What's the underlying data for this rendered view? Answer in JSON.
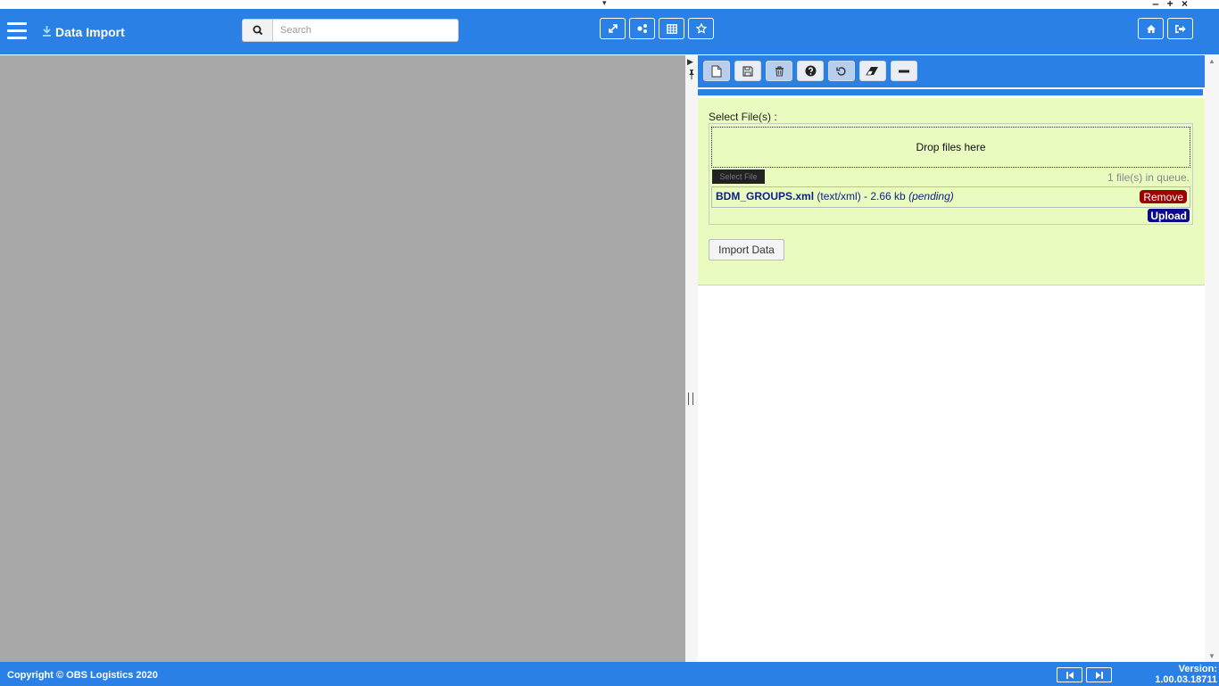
{
  "window": {
    "collapse_glyph": "▾",
    "controls": "‒ + ×"
  },
  "header": {
    "title": "Data Import",
    "search": {
      "placeholder": "Search",
      "value": ""
    },
    "tool_buttons": [
      "expand-icon",
      "share-icon",
      "grid-icon",
      "star-icon"
    ],
    "right_buttons": [
      "home-icon",
      "logout-icon"
    ]
  },
  "panel": {
    "toolbar": [
      "new-document-icon",
      "save-icon",
      "trash-icon",
      "help-icon",
      "refresh-icon",
      "eraser-icon",
      "minus-icon"
    ],
    "select_label": "Select File(s) :",
    "drop_text": "Drop files here",
    "select_file_label": "Select File",
    "queue_status": "1 file(s) in queue.",
    "file": {
      "name": "BDM_GROUPS.xml",
      "meta": "(text/xml) - 2.66 kb",
      "status": "(pending)"
    },
    "remove_label": "Remove",
    "upload_label": "Upload",
    "import_label": "Import Data"
  },
  "footer": {
    "copyright": "Copyright © OBS Logistics 2020",
    "version_label": "Version:",
    "version": "1.00.03.18711"
  },
  "colors": {
    "accent": "#2a80e4",
    "form_bg": "#e9fbbf",
    "remove": "#9c0000",
    "upload": "#0a0a8c",
    "left_pane": "#a8a8a8"
  }
}
